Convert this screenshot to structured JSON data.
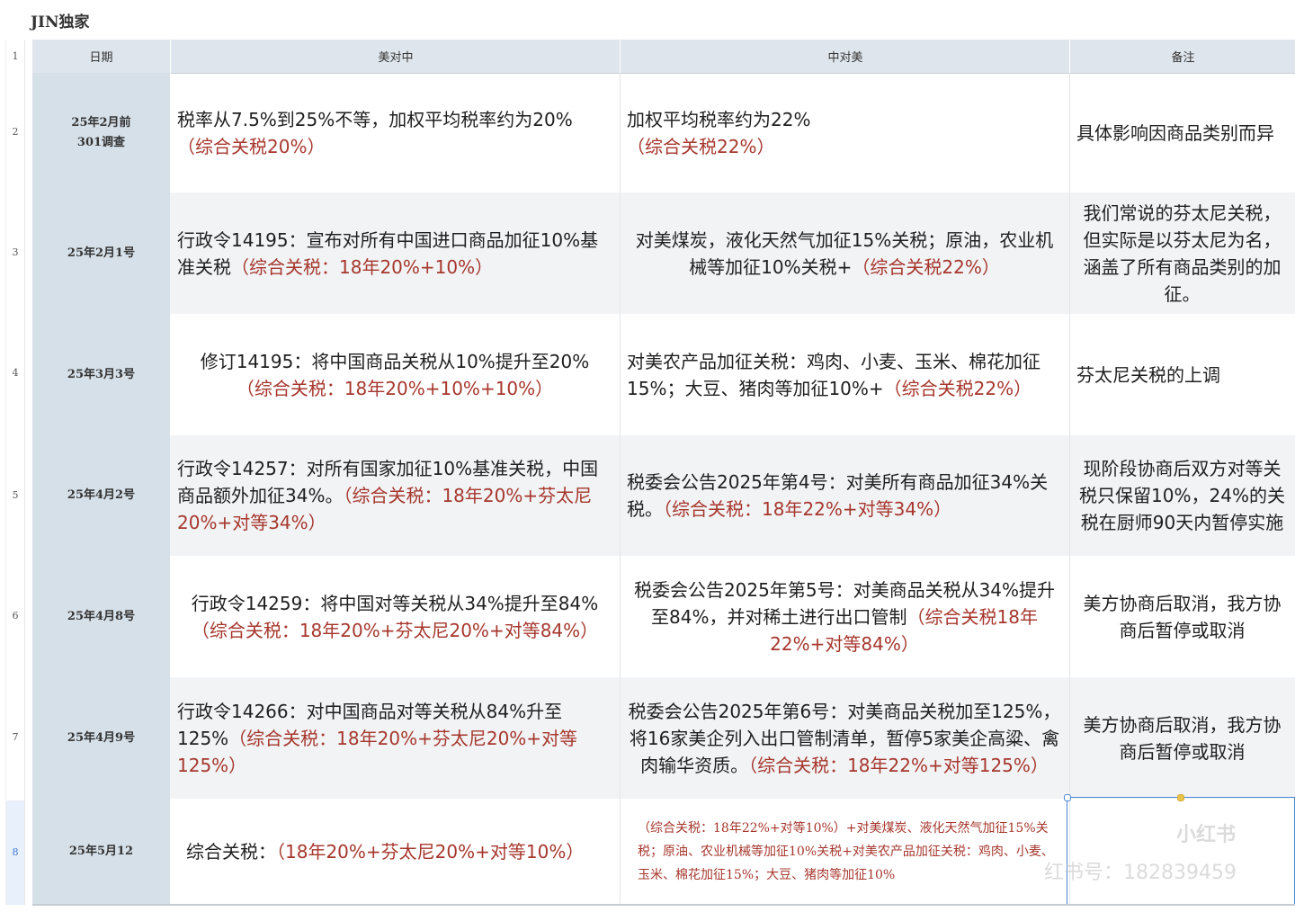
{
  "brand": "JIN独家",
  "row_numbers": [
    "1",
    "2",
    "3",
    "4",
    "5",
    "6",
    "7",
    "8"
  ],
  "headers": {
    "date": "日期",
    "us_to_cn": "美对中",
    "cn_to_us": "中对美",
    "notes": "备注"
  },
  "rows": [
    {
      "date": "25年2月前\n301调查",
      "us_main": "税率从7.5%到25%不等，加权平均税率约为20%",
      "us_red": "（综合关税20%）",
      "cn_main": "加权平均税率约为22%",
      "cn_red": "（综合关税22%）",
      "note": "具体影响因商品类别而异"
    },
    {
      "date": "25年2月1号",
      "us_main": "行政令14195：宣布对所有中国进口商品加征10%基准关税",
      "us_red": "（综合关税：18年20%+10%）",
      "cn_main": "对美煤炭，液化天然气加征15%关税；原油，农业机械等加征10%关税+",
      "cn_red": "（综合关税22%）",
      "note": "我们常说的芬太尼关税，但实际是以芬太尼为名，涵盖了所有商品类别的加征。"
    },
    {
      "date": "25年3月3号",
      "us_main": "修订14195：将中国商品关税从10%提升至20%",
      "us_red": "（综合关税：18年20%+10%+10%）",
      "cn_main": "对美农产品加征关税：鸡肉、小麦、玉米、棉花加征15%；大豆、猪肉等加征10%+",
      "cn_red": "（综合关税22%）",
      "note": "芬太尼关税的上调"
    },
    {
      "date": "25年4月2号",
      "us_main": "行政令14257：对所有国家加征10%基准关税，中国商品额外加征34%。",
      "us_red": "（综合关税：18年20%+芬太尼20%+对等34%）",
      "cn_main": "税委会公告2025年第4号：对美所有商品加征34%关税。",
      "cn_red": "（综合关税：18年22%+对等34%）",
      "note": "现阶段协商后双方对等关税只保留10%，24%的关税在厨师90天内暂停实施"
    },
    {
      "date": "25年4月8号",
      "us_main": "行政令14259：将中国对等关税从34%提升至84%",
      "us_red": "（综合关税：18年20%+芬太尼20%+对等84%）",
      "cn_main": "税委会公告2025年第5号：对美商品关税从34%提升至84%，并对稀土进行出口管制",
      "cn_red": "（综合关税18年22%+对等84%）",
      "note": "美方协商后取消，我方协商后暂停或取消"
    },
    {
      "date": "25年4月9号",
      "us_main": "行政令14266：对中国商品对等关税从84%升至125%",
      "us_red": "（综合关税：18年20%+芬太尼20%+对等125%）",
      "cn_main": "税委会公告2025年第6号：对美商品关税加至125%，将16家美企列入出口管制清单，暂停5家美企高粱、禽肉输华资质。",
      "cn_red": "（综合关税：18年22%+对等125%）",
      "note": "美方协商后取消，我方协商后暂停或取消"
    },
    {
      "date": "25年5月12",
      "us_main": "综合关税：",
      "us_red": "（18年20%+芬太尼20%+对等10%）",
      "cn_main": "",
      "cn_red": "（综合关税：18年22%+对等10%）+对美煤炭、液化天然气加征15%关税；原油、农业机械等加征10%关税+对美农产品加征关税：鸡肉、小麦、玉米、棉花加征15%；大豆、猪肉等加征10%",
      "note": ""
    }
  ],
  "watermark": {
    "logo": "小红书",
    "text": "红书号：1828394​59"
  },
  "colors": {
    "header_bg": "#dfe5ec",
    "date_col_bg": "#d6e0e8",
    "red_text": "#a6372d",
    "selection": "#4a86d8"
  }
}
